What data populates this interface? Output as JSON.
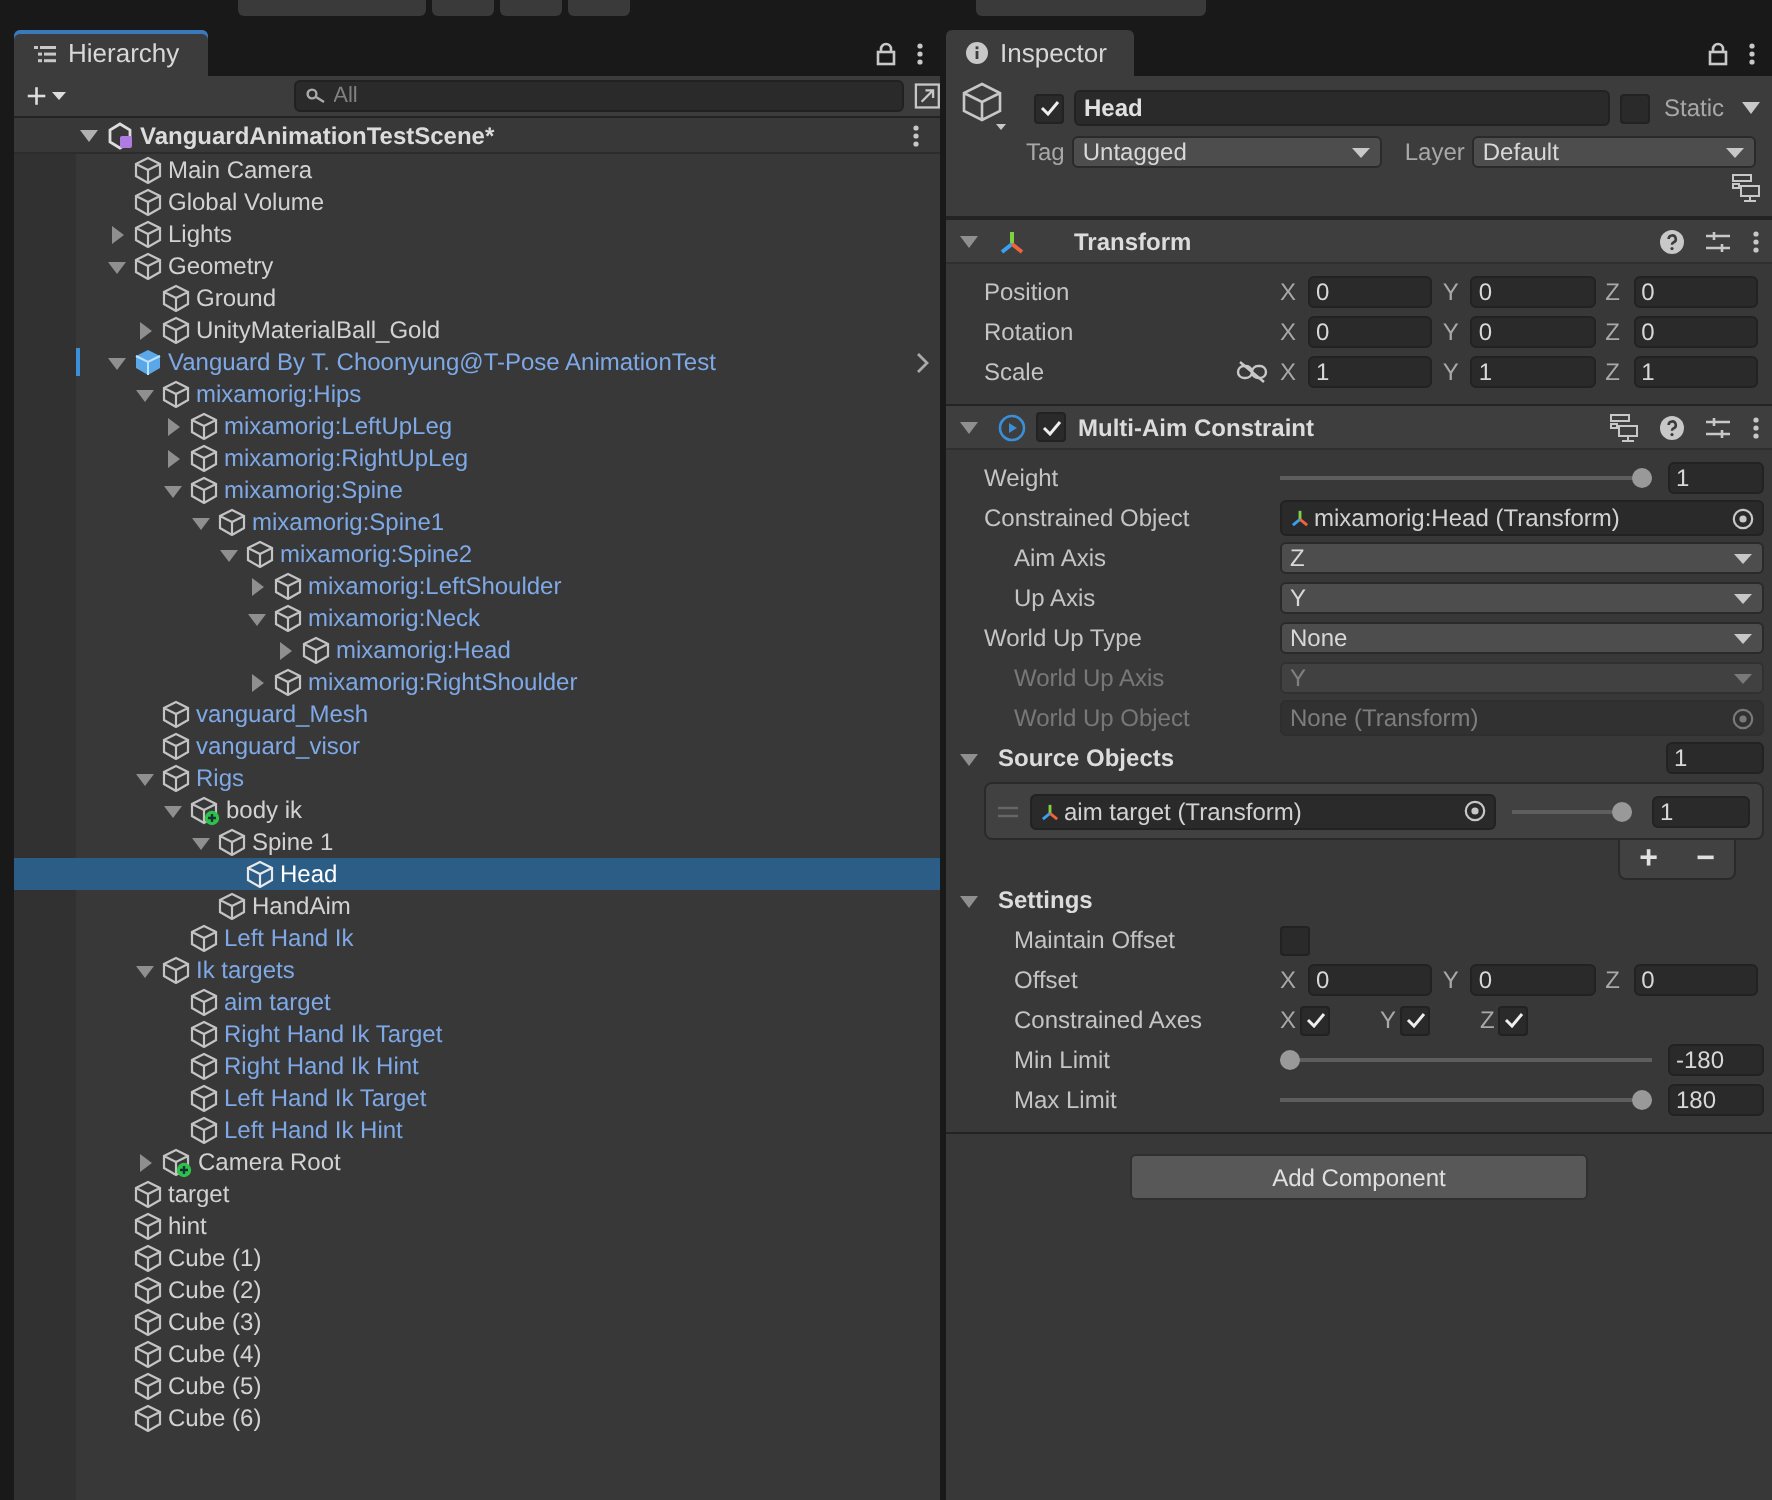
{
  "hierarchy": {
    "tab": "Hierarchy",
    "add": "+",
    "search": {
      "placeholder": "All"
    },
    "scene": {
      "name": "VanguardAnimationTestScene*",
      "expanded": true,
      "children": [
        {
          "name": "Main Camera",
          "kind": "object",
          "prefab": false,
          "selected": false
        },
        {
          "name": "Global Volume",
          "kind": "object",
          "prefab": false,
          "selected": false
        },
        {
          "name": "Lights",
          "kind": "object",
          "prefab": false,
          "expanded": false,
          "selected": false
        },
        {
          "name": "Geometry",
          "kind": "object",
          "prefab": false,
          "expanded": true,
          "selected": false,
          "children": [
            {
              "name": "Ground",
              "kind": "object",
              "prefab": false,
              "selected": false
            },
            {
              "name": "UnityMaterialBall_Gold",
              "kind": "object",
              "prefab": false,
              "expanded": false,
              "selected": false
            }
          ]
        },
        {
          "name": "Vanguard By T. Choonyung@T-Pose AnimationTest",
          "kind": "model",
          "prefab": true,
          "expanded": true,
          "selected": false,
          "children": [
            {
              "name": "mixamorig:Hips",
              "kind": "object",
              "prefab": true,
              "expanded": true,
              "selected": false,
              "children": [
                {
                  "name": "mixamorig:LeftUpLeg",
                  "kind": "object",
                  "prefab": true,
                  "expanded": false,
                  "selected": false
                },
                {
                  "name": "mixamorig:RightUpLeg",
                  "kind": "object",
                  "prefab": true,
                  "expanded": false,
                  "selected": false
                },
                {
                  "name": "mixamorig:Spine",
                  "kind": "object",
                  "prefab": true,
                  "expanded": true,
                  "selected": false,
                  "children": [
                    {
                      "name": "mixamorig:Spine1",
                      "kind": "object",
                      "prefab": true,
                      "expanded": true,
                      "selected": false,
                      "children": [
                        {
                          "name": "mixamorig:Spine2",
                          "kind": "object",
                          "prefab": true,
                          "expanded": true,
                          "selected": false,
                          "children": [
                            {
                              "name": "mixamorig:LeftShoulder",
                              "kind": "object",
                              "prefab": true,
                              "expanded": false,
                              "selected": false
                            },
                            {
                              "name": "mixamorig:Neck",
                              "kind": "object",
                              "prefab": true,
                              "expanded": true,
                              "selected": false,
                              "children": [
                                {
                                  "name": "mixamorig:Head",
                                  "kind": "object",
                                  "prefab": true,
                                  "expanded": false,
                                  "selected": false
                                }
                              ]
                            },
                            {
                              "name": "mixamorig:RightShoulder",
                              "kind": "object",
                              "prefab": true,
                              "expanded": false,
                              "selected": false
                            }
                          ]
                        }
                      ]
                    }
                  ]
                }
              ]
            },
            {
              "name": "vanguard_Mesh",
              "kind": "object",
              "prefab": true,
              "selected": false
            },
            {
              "name": "vanguard_visor",
              "kind": "object",
              "prefab": true,
              "selected": false
            },
            {
              "name": "Rigs",
              "kind": "object",
              "prefab": true,
              "expanded": true,
              "selected": false,
              "children": [
                {
                  "name": "body ik",
                  "kind": "rig",
                  "prefab": false,
                  "expanded": true,
                  "selected": false,
                  "children": [
                    {
                      "name": "Spine 1",
                      "kind": "object",
                      "prefab": false,
                      "expanded": true,
                      "selected": false,
                      "children": [
                        {
                          "name": "Head",
                          "kind": "object",
                          "prefab": false,
                          "selected": true
                        }
                      ]
                    },
                    {
                      "name": "HandAim",
                      "kind": "object",
                      "prefab": false,
                      "selected": false
                    }
                  ]
                },
                {
                  "name": "Left Hand Ik",
                  "kind": "object",
                  "prefab": true,
                  "selected": false
                }
              ]
            },
            {
              "name": "Ik targets",
              "kind": "object",
              "prefab": true,
              "expanded": true,
              "selected": false,
              "children": [
                {
                  "name": "aim target",
                  "kind": "object",
                  "prefab": true,
                  "selected": false
                },
                {
                  "name": "Right Hand Ik Target",
                  "kind": "object",
                  "prefab": true,
                  "selected": false
                },
                {
                  "name": "Right Hand Ik Hint",
                  "kind": "object",
                  "prefab": true,
                  "selected": false
                },
                {
                  "name": "Left Hand Ik Target",
                  "kind": "object",
                  "prefab": true,
                  "selected": false
                },
                {
                  "name": "Left Hand Ik Hint",
                  "kind": "object",
                  "prefab": true,
                  "selected": false
                }
              ]
            },
            {
              "name": "Camera Root",
              "kind": "rig",
              "prefab": false,
              "expanded": false,
              "selected": false
            }
          ]
        },
        {
          "name": "target",
          "kind": "object",
          "prefab": false,
          "selected": false
        },
        {
          "name": "hint",
          "kind": "object",
          "prefab": false,
          "selected": false
        },
        {
          "name": "Cube (1)",
          "kind": "object",
          "prefab": false,
          "selected": false
        },
        {
          "name": "Cube (2)",
          "kind": "object",
          "prefab": false,
          "selected": false
        },
        {
          "name": "Cube (3)",
          "kind": "object",
          "prefab": false,
          "selected": false
        },
        {
          "name": "Cube (4)",
          "kind": "object",
          "prefab": false,
          "selected": false
        },
        {
          "name": "Cube (5)",
          "kind": "object",
          "prefab": false,
          "selected": false
        },
        {
          "name": "Cube (6)",
          "kind": "object",
          "prefab": false,
          "selected": false
        }
      ]
    }
  },
  "inspector": {
    "tab": "Inspector",
    "object": {
      "active": true,
      "name": "Head",
      "static": false,
      "static_label": "Static",
      "tag_label": "Tag",
      "tag": "Untagged",
      "layer_label": "Layer",
      "layer": "Default"
    },
    "transform": {
      "title": "Transform",
      "expanded": true,
      "rows": [
        {
          "label": "Position",
          "fields": [
            {
              "axis": "X",
              "value": "0"
            },
            {
              "axis": "Y",
              "value": "0"
            },
            {
              "axis": "Z",
              "value": "0"
            }
          ]
        },
        {
          "label": "Rotation",
          "fields": [
            {
              "axis": "X",
              "value": "0"
            },
            {
              "axis": "Y",
              "value": "0"
            },
            {
              "axis": "Z",
              "value": "0"
            }
          ]
        },
        {
          "label": "Scale",
          "proportional": false,
          "fields": [
            {
              "axis": "X",
              "value": "1"
            },
            {
              "axis": "Y",
              "value": "1"
            },
            {
              "axis": "Z",
              "value": "1"
            }
          ]
        }
      ]
    },
    "constraint": {
      "title": "Multi-Aim Constraint",
      "enabled": true,
      "expanded": true,
      "rows": [
        {
          "kind": "slider",
          "label": "Weight",
          "indented": false,
          "disabled": false,
          "level": 1,
          "value": "1"
        },
        {
          "kind": "object",
          "label": "Constrained Object",
          "indented": false,
          "disabled": false,
          "value": "mixamorig:Head (Transform)",
          "transform_icon": true
        },
        {
          "kind": "dropdown",
          "label": "Aim Axis",
          "indented": true,
          "disabled": false,
          "value": "Z"
        },
        {
          "kind": "dropdown",
          "label": "Up Axis",
          "indented": true,
          "disabled": false,
          "value": "Y"
        },
        {
          "kind": "dropdown",
          "label": "World Up Type",
          "indented": false,
          "disabled": false,
          "value": "None"
        },
        {
          "kind": "dropdown",
          "label": "World Up Axis",
          "indented": true,
          "disabled": true,
          "value": "Y"
        },
        {
          "kind": "object",
          "label": "World Up Object",
          "indented": true,
          "disabled": true,
          "value": "None (Transform)",
          "transform_icon": false
        }
      ],
      "sources": {
        "title": "Source Objects",
        "expanded": true,
        "count": "1",
        "items": [
          {
            "name": "aim target (Transform)",
            "level": 1,
            "value": "1"
          }
        ],
        "add": "+",
        "remove": "−"
      },
      "settings": {
        "title": "Settings",
        "expanded": true,
        "rows": [
          {
            "kind": "checkbox",
            "label": "Maintain Offset",
            "checked": false
          },
          {
            "kind": "vector",
            "label": "Offset",
            "fields": [
              {
                "axis": "X",
                "value": "0"
              },
              {
                "axis": "Y",
                "value": "0"
              },
              {
                "axis": "Z",
                "value": "0"
              }
            ]
          },
          {
            "kind": "axes",
            "label": "Constrained Axes",
            "axes": [
              {
                "axis": "X",
                "checked": true
              },
              {
                "axis": "Y",
                "checked": true
              },
              {
                "axis": "Z",
                "checked": true
              }
            ]
          },
          {
            "kind": "slider",
            "label": "Min Limit",
            "level": 0,
            "value": "-180"
          },
          {
            "kind": "slider",
            "label": "Max Limit",
            "level": 1,
            "value": "180"
          }
        ]
      }
    },
    "add_component": "Add Component"
  }
}
